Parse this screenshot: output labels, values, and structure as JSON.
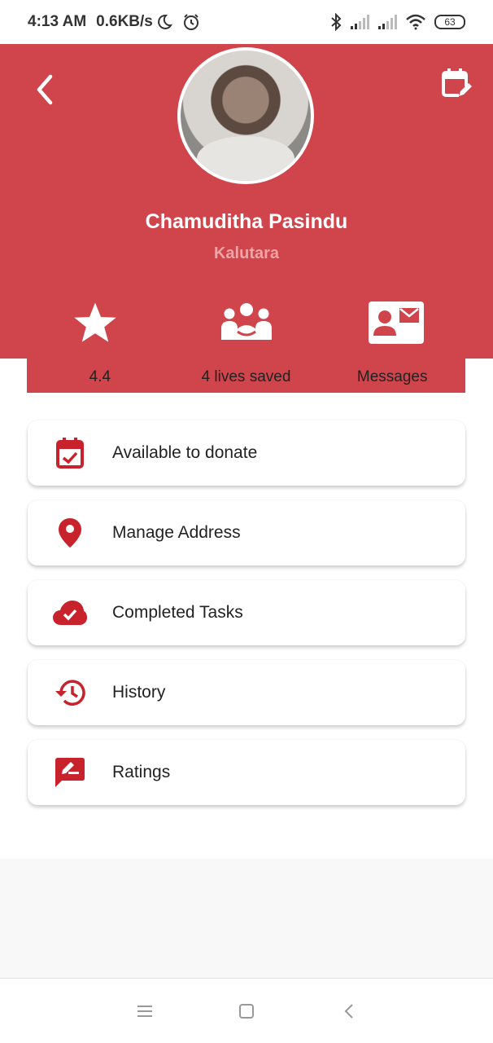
{
  "status_bar": {
    "time": "4:13 AM",
    "net_speed": "0.6KB/s",
    "battery": "63",
    "icons": [
      "moon-icon",
      "alarm-icon",
      "bluetooth-icon",
      "signal-icon",
      "signal-icon",
      "wifi-icon",
      "battery-icon"
    ]
  },
  "header": {
    "background": "#d0444b",
    "name": "Chamuditha Pasindu",
    "location": "Kalutara",
    "icons": [
      "back-icon",
      "calendar-edit-icon"
    ]
  },
  "stats": [
    {
      "icon": "star-icon",
      "label": "4.4"
    },
    {
      "icon": "group-icon",
      "label": "4 lives saved"
    },
    {
      "icon": "contact-mail-icon",
      "label": "Messages"
    }
  ],
  "menu": {
    "accent": "#c8232c",
    "items": [
      {
        "icon": "calendar-check-icon",
        "label": "Available to donate"
      },
      {
        "icon": "location-pin-icon",
        "label": "Manage Address"
      },
      {
        "icon": "cloud-done-icon",
        "label": "Completed Tasks"
      },
      {
        "icon": "history-icon",
        "label": "History"
      },
      {
        "icon": "rate-review-icon",
        "label": "Ratings"
      }
    ]
  },
  "nav_bar": {
    "icons": [
      "menu-icon",
      "home-icon",
      "back-nav-icon"
    ]
  }
}
